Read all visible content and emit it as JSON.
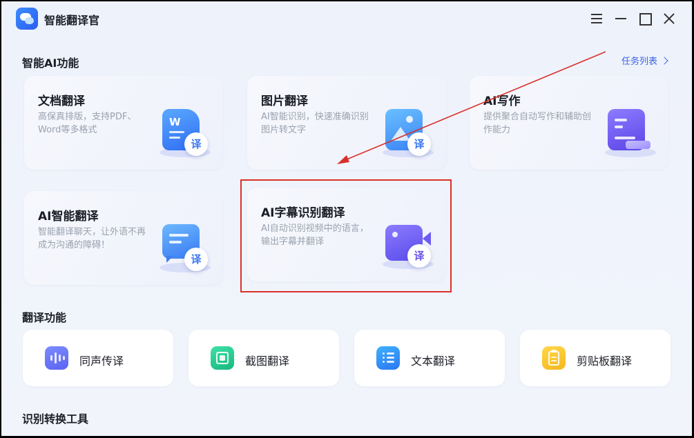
{
  "app": {
    "title": "智能翻译官"
  },
  "sections": {
    "ai": "智能AI功能",
    "translate": "翻译功能",
    "tools": "识别转换工具"
  },
  "task_link": "任务列表",
  "cards": [
    {
      "title": "文档翻译",
      "desc": "高保真排版，支持PDF、Word等多格式",
      "badge": "译",
      "letter": "W"
    },
    {
      "title": "图片翻译",
      "desc": "AI智能识别，快速准确识别图片转文字",
      "badge": "译"
    },
    {
      "title": "AI写作",
      "desc": "提供聚合自动写作和辅助创作能力"
    },
    {
      "title": "AI智能翻译",
      "desc": "智能翻译聊天，让外语不再成为沟通的障碍！",
      "badge": "译"
    },
    {
      "title": "AI字幕识别翻译",
      "desc": "AI自动识别视频中的语言，输出字幕并翻译",
      "badge": "译"
    }
  ],
  "tools": [
    {
      "label": "同声传译"
    },
    {
      "label": "截图翻译"
    },
    {
      "label": "文本翻译"
    },
    {
      "label": "剪贴板翻译"
    }
  ],
  "colors": {
    "accent": "#3a63e6",
    "annotation": "#d9302a"
  }
}
